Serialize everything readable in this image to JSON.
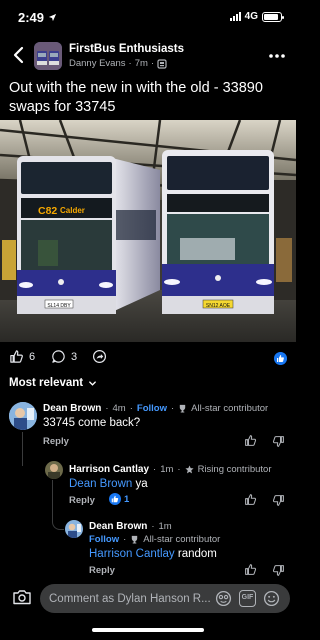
{
  "status_bar": {
    "time": "2:49",
    "network": "4G",
    "battery_level": 0.85,
    "icons": [
      "location-arrow-icon",
      "signal-bars-icon",
      "battery-icon"
    ]
  },
  "header": {
    "group_name": "FirstBus Enthusiasts",
    "author": "Danny Evans",
    "time": "7m",
    "icons": [
      "back-arrow-icon",
      "group-privacy-icon",
      "more-options-icon"
    ]
  },
  "post": {
    "text": "Out with the new in with the old - 33890 swaps for 33745",
    "photo": {
      "left_bus": {
        "destination_number": "C82",
        "destination_name": "Calder",
        "plate": "SL14 DBY"
      },
      "right_bus": {
        "plate": "SN12 AOE"
      }
    }
  },
  "reactions": {
    "likes": "6",
    "comments": "3",
    "icons": [
      "like-icon",
      "comment-icon",
      "share-icon",
      "like-badge-icon"
    ]
  },
  "filter": {
    "label": "Most relevant"
  },
  "comments": [
    {
      "author": "Dean Brown",
      "time": "4m",
      "follow": "Follow",
      "badge": "All-star contributor",
      "text": "33745 come back?",
      "reply": "Reply"
    },
    {
      "author": "Harrison Cantlay",
      "time": "1m",
      "badge": "Rising contributor",
      "mention": "Dean Brown",
      "text": "ya",
      "reply": "Reply",
      "reaction_count": "1"
    },
    {
      "author": "Dean Brown",
      "time": "1m",
      "follow": "Follow",
      "badge": "All-star contributor",
      "mention": "Harrison Cantlay",
      "text": "random",
      "reply": "Reply"
    }
  ],
  "composer": {
    "placeholder": "Comment as Dylan Hanson R...",
    "gif_label": "GIF"
  },
  "colors": {
    "background": "#000000",
    "link": "#4599ff",
    "like_blue": "#1877f2",
    "muted": "#b0b3b8"
  }
}
